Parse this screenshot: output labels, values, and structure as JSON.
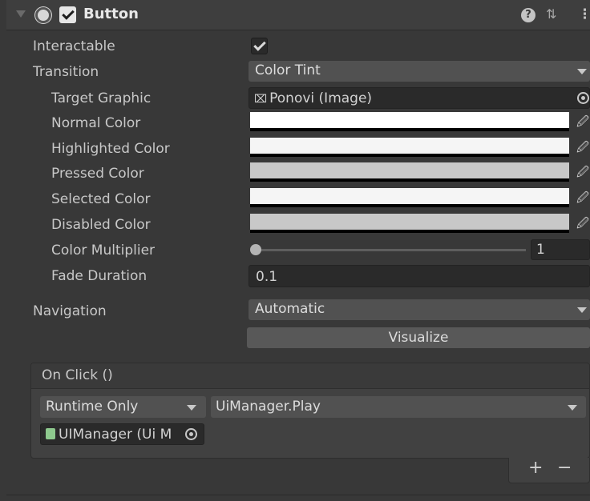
{
  "component": {
    "title": "Button",
    "enabled": true
  },
  "fields": {
    "interactable": {
      "label": "Interactable",
      "checked": true
    },
    "transition": {
      "label": "Transition",
      "value": "Color Tint"
    },
    "target_graphic": {
      "label": "Target Graphic",
      "value": "Ponovi (Image)"
    },
    "normal_color": {
      "label": "Normal Color",
      "color": "#ffffff"
    },
    "highlighted_color": {
      "label": "Highlighted Color",
      "color": "#f5f5f5"
    },
    "pressed_color": {
      "label": "Pressed Color",
      "color": "#c8c8c8"
    },
    "selected_color": {
      "label": "Selected Color",
      "color": "#f5f5f5"
    },
    "disabled_color": {
      "label": "Disabled Color",
      "color": "#c8c8c8"
    },
    "color_multiplier": {
      "label": "Color Multiplier",
      "value": "1"
    },
    "fade_duration": {
      "label": "Fade Duration",
      "value": "0.1"
    },
    "navigation": {
      "label": "Navigation",
      "value": "Automatic"
    },
    "visualize": {
      "label": "Visualize"
    }
  },
  "on_click": {
    "title": "On Click ()",
    "runtime": "Runtime Only",
    "function": "UiManager.Play",
    "target": "UIManager (Ui M"
  },
  "gadgets": {
    "add": "+",
    "remove": "−"
  },
  "icons": {
    "help": "?",
    "preset": "⇅",
    "menu": "⋮",
    "picker": "🖉",
    "image": "⌧"
  }
}
